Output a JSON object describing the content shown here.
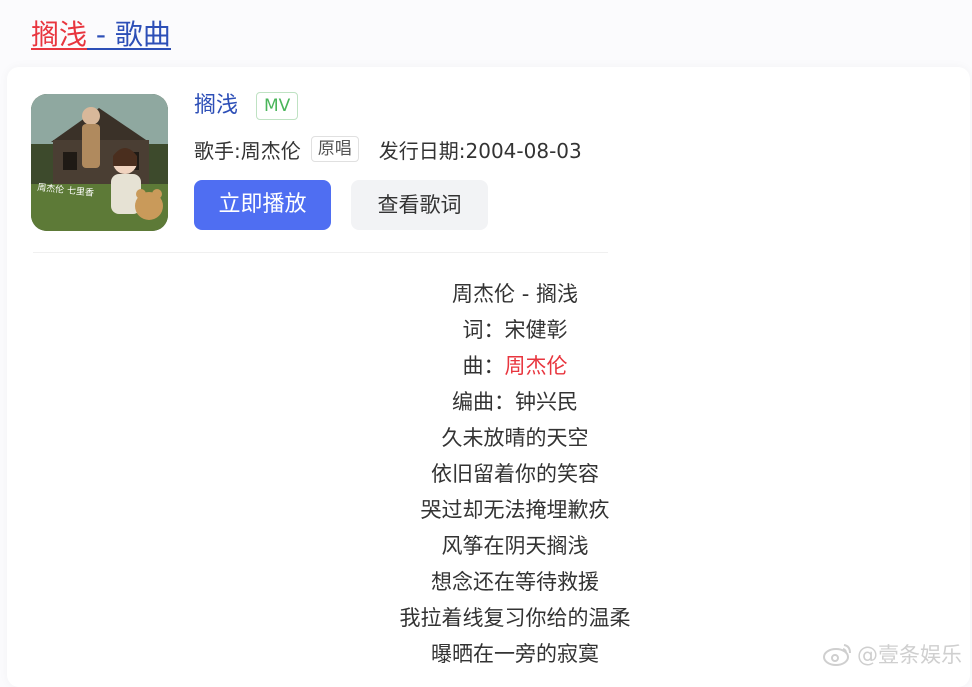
{
  "header": {
    "song_title": "搁浅",
    "title_suffix": " - 歌曲"
  },
  "song": {
    "name": "搁浅",
    "mv_badge": "MV",
    "singer_label": "歌手:",
    "singer": "周杰伦",
    "original_badge": "原唱",
    "release_label": "发行日期:",
    "release_date": "2004-08-03",
    "cover_text": "周杰伦 七里香"
  },
  "buttons": {
    "play": "立即播放",
    "view_lyrics": "查看歌词"
  },
  "lyrics": {
    "header": "周杰伦 - 搁浅",
    "lyricist_label": "词：",
    "lyricist": "宋健彰",
    "composer_label": "曲：",
    "composer": "周杰伦",
    "arranger_label": "编曲：",
    "arranger": "钟兴民",
    "lines": [
      "久未放晴的天空",
      "依旧留着你的笑容",
      "哭过却无法掩埋歉疚",
      "风筝在阴天搁浅",
      "想念还在等待救援",
      "我拉着线复习你给的温柔",
      "曝晒在一旁的寂寞"
    ]
  },
  "watermark": {
    "text": "@壹条娱乐"
  },
  "colors": {
    "accent_red": "#e8353e",
    "link_blue": "#2d4fb7",
    "play_button": "#4f6ef2",
    "mv_green": "#4ab55a"
  }
}
